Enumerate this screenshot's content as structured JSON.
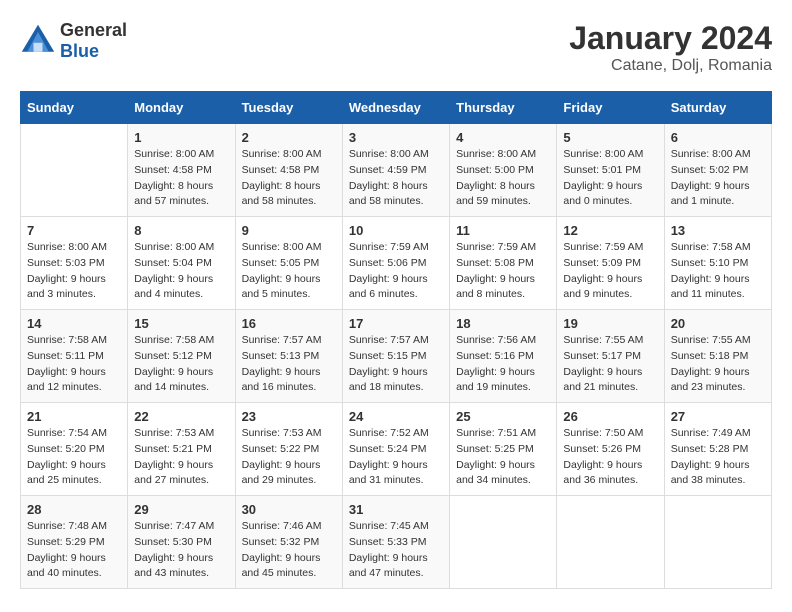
{
  "header": {
    "logo_general": "General",
    "logo_blue": "Blue",
    "title": "January 2024",
    "subtitle": "Catane, Dolj, Romania"
  },
  "columns": [
    "Sunday",
    "Monday",
    "Tuesday",
    "Wednesday",
    "Thursday",
    "Friday",
    "Saturday"
  ],
  "weeks": [
    [
      {
        "day": "",
        "info": ""
      },
      {
        "day": "1",
        "info": "Sunrise: 8:00 AM\nSunset: 4:58 PM\nDaylight: 8 hours\nand 57 minutes."
      },
      {
        "day": "2",
        "info": "Sunrise: 8:00 AM\nSunset: 4:58 PM\nDaylight: 8 hours\nand 58 minutes."
      },
      {
        "day": "3",
        "info": "Sunrise: 8:00 AM\nSunset: 4:59 PM\nDaylight: 8 hours\nand 58 minutes."
      },
      {
        "day": "4",
        "info": "Sunrise: 8:00 AM\nSunset: 5:00 PM\nDaylight: 8 hours\nand 59 minutes."
      },
      {
        "day": "5",
        "info": "Sunrise: 8:00 AM\nSunset: 5:01 PM\nDaylight: 9 hours\nand 0 minutes."
      },
      {
        "day": "6",
        "info": "Sunrise: 8:00 AM\nSunset: 5:02 PM\nDaylight: 9 hours\nand 1 minute."
      }
    ],
    [
      {
        "day": "7",
        "info": "Sunrise: 8:00 AM\nSunset: 5:03 PM\nDaylight: 9 hours\nand 3 minutes."
      },
      {
        "day": "8",
        "info": "Sunrise: 8:00 AM\nSunset: 5:04 PM\nDaylight: 9 hours\nand 4 minutes."
      },
      {
        "day": "9",
        "info": "Sunrise: 8:00 AM\nSunset: 5:05 PM\nDaylight: 9 hours\nand 5 minutes."
      },
      {
        "day": "10",
        "info": "Sunrise: 7:59 AM\nSunset: 5:06 PM\nDaylight: 9 hours\nand 6 minutes."
      },
      {
        "day": "11",
        "info": "Sunrise: 7:59 AM\nSunset: 5:08 PM\nDaylight: 9 hours\nand 8 minutes."
      },
      {
        "day": "12",
        "info": "Sunrise: 7:59 AM\nSunset: 5:09 PM\nDaylight: 9 hours\nand 9 minutes."
      },
      {
        "day": "13",
        "info": "Sunrise: 7:58 AM\nSunset: 5:10 PM\nDaylight: 9 hours\nand 11 minutes."
      }
    ],
    [
      {
        "day": "14",
        "info": "Sunrise: 7:58 AM\nSunset: 5:11 PM\nDaylight: 9 hours\nand 12 minutes."
      },
      {
        "day": "15",
        "info": "Sunrise: 7:58 AM\nSunset: 5:12 PM\nDaylight: 9 hours\nand 14 minutes."
      },
      {
        "day": "16",
        "info": "Sunrise: 7:57 AM\nSunset: 5:13 PM\nDaylight: 9 hours\nand 16 minutes."
      },
      {
        "day": "17",
        "info": "Sunrise: 7:57 AM\nSunset: 5:15 PM\nDaylight: 9 hours\nand 18 minutes."
      },
      {
        "day": "18",
        "info": "Sunrise: 7:56 AM\nSunset: 5:16 PM\nDaylight: 9 hours\nand 19 minutes."
      },
      {
        "day": "19",
        "info": "Sunrise: 7:55 AM\nSunset: 5:17 PM\nDaylight: 9 hours\nand 21 minutes."
      },
      {
        "day": "20",
        "info": "Sunrise: 7:55 AM\nSunset: 5:18 PM\nDaylight: 9 hours\nand 23 minutes."
      }
    ],
    [
      {
        "day": "21",
        "info": "Sunrise: 7:54 AM\nSunset: 5:20 PM\nDaylight: 9 hours\nand 25 minutes."
      },
      {
        "day": "22",
        "info": "Sunrise: 7:53 AM\nSunset: 5:21 PM\nDaylight: 9 hours\nand 27 minutes."
      },
      {
        "day": "23",
        "info": "Sunrise: 7:53 AM\nSunset: 5:22 PM\nDaylight: 9 hours\nand 29 minutes."
      },
      {
        "day": "24",
        "info": "Sunrise: 7:52 AM\nSunset: 5:24 PM\nDaylight: 9 hours\nand 31 minutes."
      },
      {
        "day": "25",
        "info": "Sunrise: 7:51 AM\nSunset: 5:25 PM\nDaylight: 9 hours\nand 34 minutes."
      },
      {
        "day": "26",
        "info": "Sunrise: 7:50 AM\nSunset: 5:26 PM\nDaylight: 9 hours\nand 36 minutes."
      },
      {
        "day": "27",
        "info": "Sunrise: 7:49 AM\nSunset: 5:28 PM\nDaylight: 9 hours\nand 38 minutes."
      }
    ],
    [
      {
        "day": "28",
        "info": "Sunrise: 7:48 AM\nSunset: 5:29 PM\nDaylight: 9 hours\nand 40 minutes."
      },
      {
        "day": "29",
        "info": "Sunrise: 7:47 AM\nSunset: 5:30 PM\nDaylight: 9 hours\nand 43 minutes."
      },
      {
        "day": "30",
        "info": "Sunrise: 7:46 AM\nSunset: 5:32 PM\nDaylight: 9 hours\nand 45 minutes."
      },
      {
        "day": "31",
        "info": "Sunrise: 7:45 AM\nSunset: 5:33 PM\nDaylight: 9 hours\nand 47 minutes."
      },
      {
        "day": "",
        "info": ""
      },
      {
        "day": "",
        "info": ""
      },
      {
        "day": "",
        "info": ""
      }
    ]
  ]
}
